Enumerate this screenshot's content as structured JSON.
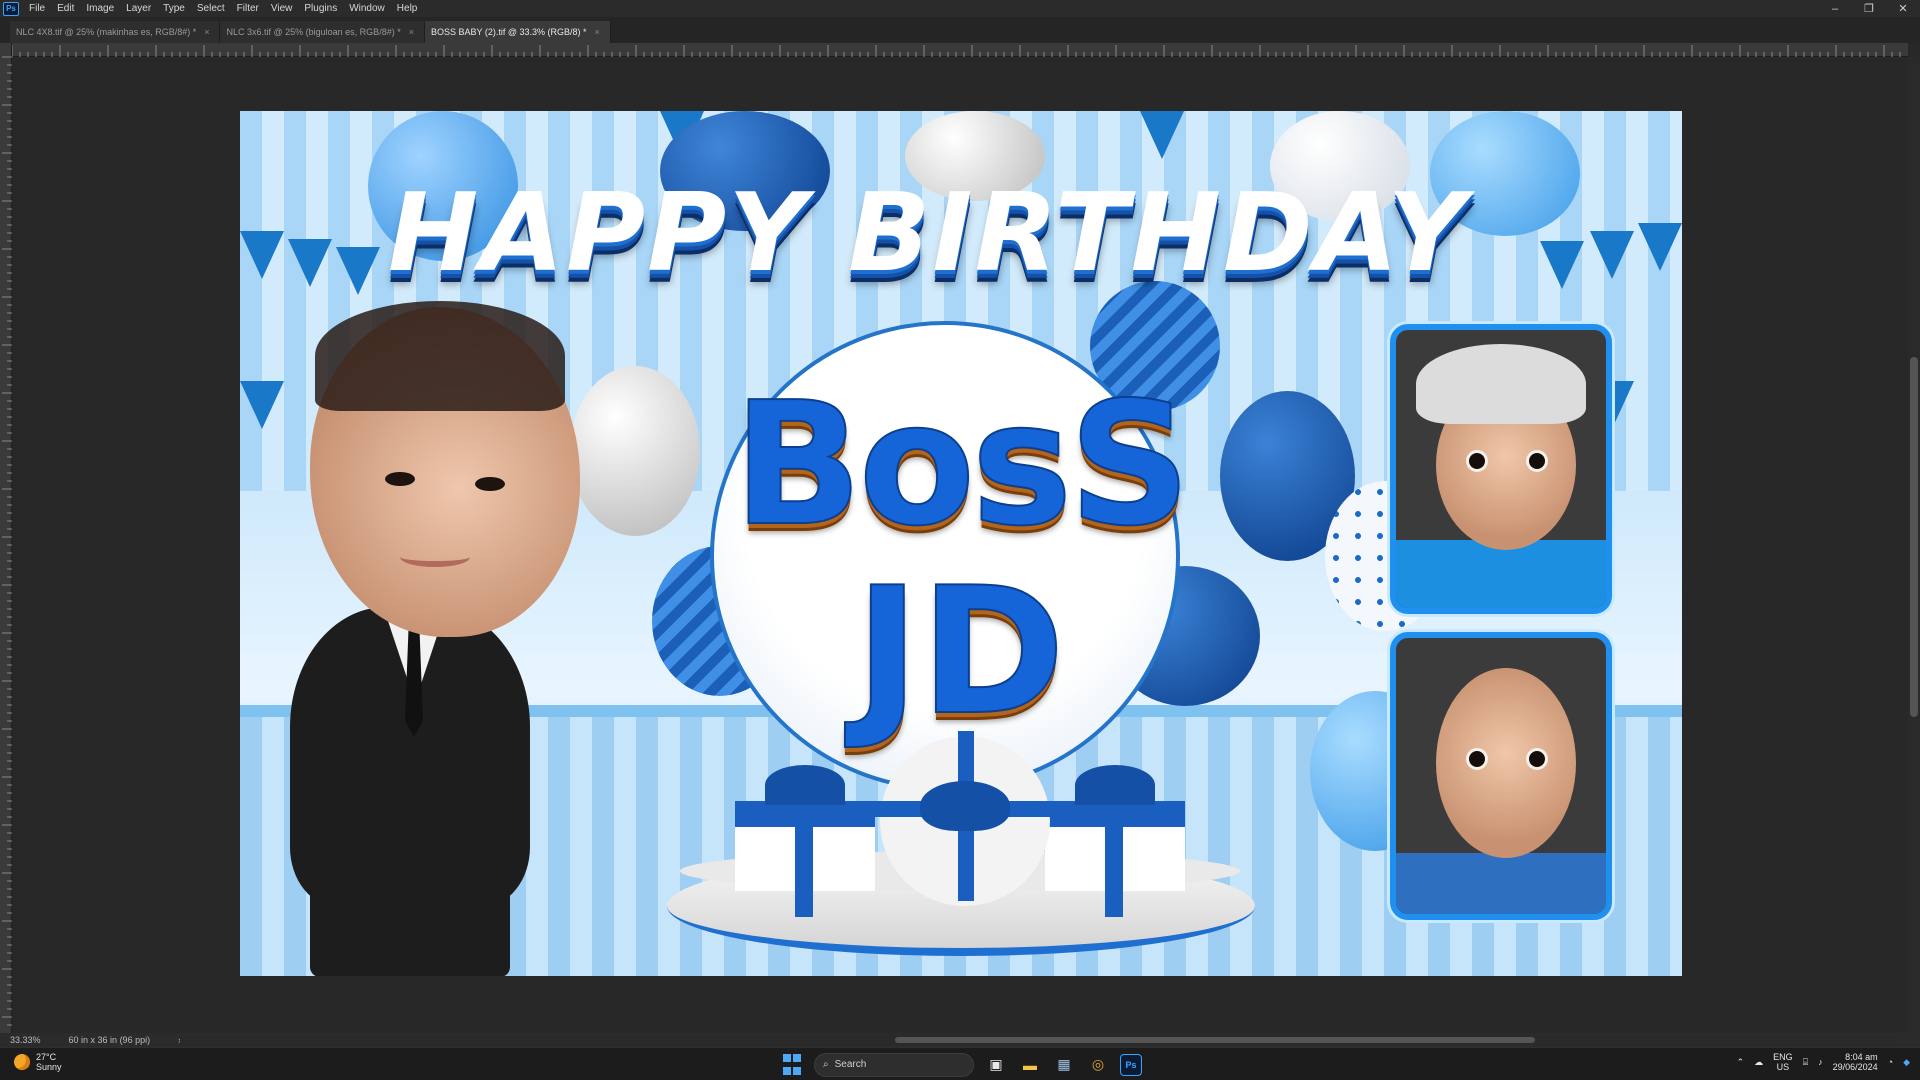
{
  "app": {
    "logo": "Ps"
  },
  "menu": [
    "File",
    "Edit",
    "Image",
    "Layer",
    "Type",
    "Select",
    "Filter",
    "View",
    "Plugins",
    "Window",
    "Help"
  ],
  "window_controls": {
    "minimize": "–",
    "restore": "❐",
    "close": "✕"
  },
  "tabs": [
    {
      "label": "NLC 4X8.tif @ 25% (makinhas es, RGB/8#) *",
      "close": "×",
      "active": false
    },
    {
      "label": "NLC 3x6.tif @ 25% (biguloan es, RGB/8#) *",
      "close": "×",
      "active": false
    },
    {
      "label": "BOSS BABY (2).tif @ 33.3% (RGB/8) *",
      "close": "×",
      "active": true
    }
  ],
  "canvas": {
    "title": "HAPPY BIRTHDAY",
    "name_line1": "BosS",
    "name_line2": "JD"
  },
  "status": {
    "zoom": "33.33%",
    "doc_size": "60 in x 36 in (96 ppi)",
    "arrow": "›"
  },
  "taskbar": {
    "weather_temp": "27°C",
    "weather_desc": "Sunny",
    "search_placeholder": "Search",
    "lang_top": "ENG",
    "lang_bottom": "US",
    "time": "8:04 am",
    "date": "29/06/2024"
  },
  "colors": {
    "accent": "#1f8ff0",
    "photoshop_blue": "#31a8ff",
    "title_shadow": "#1551a8",
    "name_orange": "#b3651c"
  }
}
